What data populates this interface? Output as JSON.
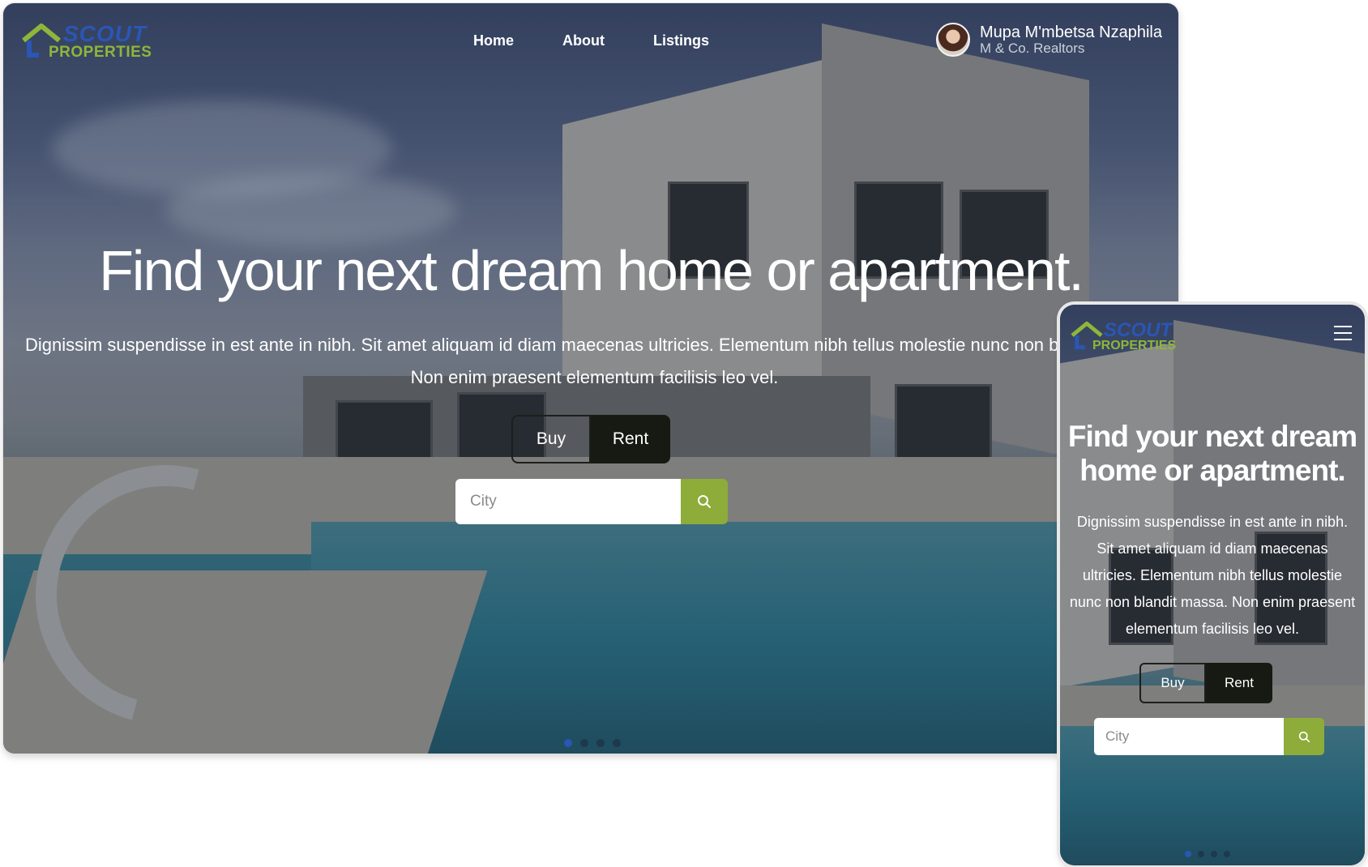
{
  "brand": {
    "logo_line1": "SCOUT",
    "logo_line2": "PROPERTIES",
    "primary_color": "#2a56b5",
    "accent_color": "#8fb63a",
    "search_button_color": "#8dac3a",
    "logo_icon": "house-icon"
  },
  "desktop": {
    "nav": {
      "links": [
        {
          "label": "Home"
        },
        {
          "label": "About"
        },
        {
          "label": "Listings"
        }
      ]
    },
    "user": {
      "name": "Mupa M'mbetsa Nzaphila",
      "company": "M & Co. Realtors"
    },
    "hero": {
      "title": "Find your next dream home or apartment.",
      "text": "Dignissim suspendisse in est ante in nibh. Sit amet aliquam id diam maecenas ultricies. Elementum nibh tellus molestie nunc non blandit massa. Non enim praesent elementum facilisis leo vel.",
      "buy_label": "Buy",
      "rent_label": "Rent",
      "search_placeholder": "City",
      "search_icon": "search-icon"
    },
    "carousel": {
      "slides": 4,
      "active_index": 0
    }
  },
  "mobile": {
    "menu_icon": "hamburger-menu-icon",
    "hero": {
      "title": "Find your next dream home or apartment.",
      "text": "Dignissim suspendisse in est ante in nibh. Sit amet aliquam id diam maecenas ultricies. Elementum nibh tellus molestie nunc non blandit massa. Non enim praesent elementum facilisis leo vel.",
      "buy_label": "Buy",
      "rent_label": "Rent",
      "search_placeholder": "City",
      "search_icon": "search-icon"
    },
    "carousel": {
      "slides": 4,
      "active_index": 0
    }
  }
}
